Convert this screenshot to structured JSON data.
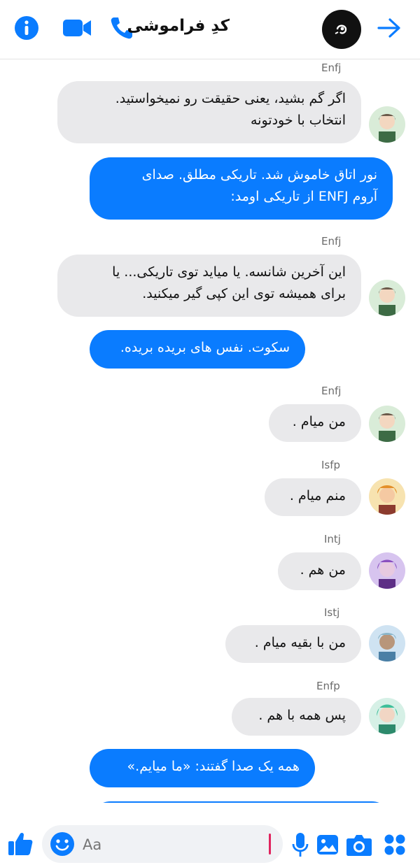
{
  "header": {
    "title": "کدِ فراموشی",
    "icons": [
      "info-icon",
      "video-call-icon",
      "phone-call-icon",
      "group-avatar",
      "forward-arrow-icon"
    ]
  },
  "messages": [
    {
      "sender": "Enfj",
      "text": "اگر گم بشید، یعنی حقیقت رو نمیخواستید.\nانتخاب با خودتونه",
      "direction": "in"
    },
    {
      "text": "نور اتاق خاموش شد. تاریکی مطلق. صدای\nآروم ENFJ از تاریکی اومد:",
      "direction": "out"
    },
    {
      "sender": "Enfj",
      "text": "این آخرین شانسه. یا میاید توی تاریکی... یا\nبرای همیشه توی این کپی گیر میکنید.",
      "direction": "in"
    },
    {
      "text": "سکوت. نفس های بریده بریده.",
      "direction": "out"
    },
    {
      "sender": "Enfj",
      "text": "من میام .",
      "direction": "in"
    },
    {
      "sender": "Isfp",
      "text": "منم میام .",
      "direction": "in"
    },
    {
      "sender": "Intj",
      "text": "من هم .",
      "direction": "in"
    },
    {
      "sender": "Istj",
      "text": "من با بقیه میام .",
      "direction": "in"
    },
    {
      "sender": "Enfp",
      "text": "پس همه با هم .",
      "direction": "in"
    },
    {
      "text": "همه یک صدا گفتند: «ما میایم.»",
      "direction": "out"
    }
  ],
  "composer": {
    "placeholder": "Aa",
    "icons": [
      "like-icon",
      "emoji-icon",
      "microphone-icon",
      "gallery-icon",
      "camera-icon",
      "apps-icon"
    ]
  },
  "colors": {
    "accent": "#0a7cff",
    "incoming_bubble": "#e9e9eb"
  }
}
